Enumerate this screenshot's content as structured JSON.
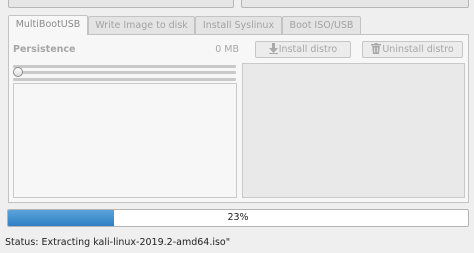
{
  "tabs": [
    {
      "label": "MultiBootUSB",
      "active": true
    },
    {
      "label": "Write Image to disk",
      "active": false
    },
    {
      "label": "Install Syslinux",
      "active": false
    },
    {
      "label": "Boot ISO/USB",
      "active": false
    }
  ],
  "persistence": {
    "label": "Persistence",
    "size": "0 MB",
    "slider_value": 0
  },
  "buttons": {
    "install": "Install distro",
    "uninstall": "Uninstall distro"
  },
  "progress": {
    "percent_label": "23%",
    "fraction": 0.23,
    "color": "#3a8fd3"
  },
  "status": "Status: Extracting kali-linux-2019.2-amd64.iso\""
}
